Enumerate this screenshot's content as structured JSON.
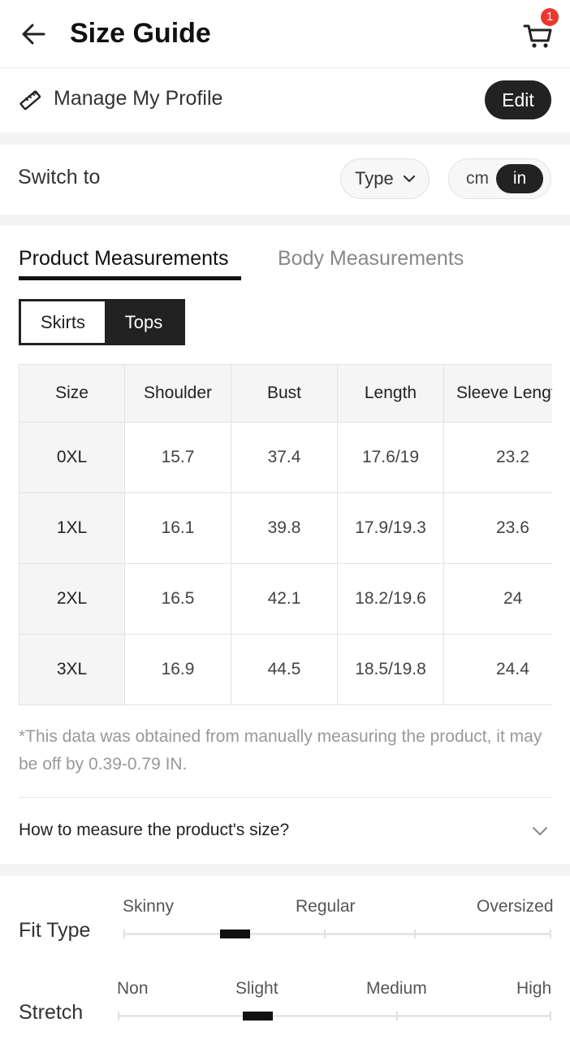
{
  "header": {
    "title": "Size Guide",
    "cart_count": "1"
  },
  "profile": {
    "label": "Manage My Profile",
    "edit_label": "Edit"
  },
  "switch": {
    "label": "Switch to",
    "type_label": "Type",
    "unit_cm": "cm",
    "unit_in": "in",
    "selected_unit": "in"
  },
  "tabs": [
    {
      "label": "Product Measurements",
      "active": true
    },
    {
      "label": "Body Measurements",
      "active": false
    }
  ],
  "segments": [
    {
      "label": "Skirts",
      "active": false
    },
    {
      "label": "Tops",
      "active": true
    }
  ],
  "table": {
    "headers": [
      "Size",
      "Shoulder",
      "Bust",
      "Length",
      "Sleeve Length"
    ],
    "rows": [
      [
        "0XL",
        "15.7",
        "37.4",
        "17.6/19",
        "23.2"
      ],
      [
        "1XL",
        "16.1",
        "39.8",
        "17.9/19.3",
        "23.6"
      ],
      [
        "2XL",
        "16.5",
        "42.1",
        "18.2/19.6",
        "24"
      ],
      [
        "3XL",
        "16.9",
        "44.5",
        "18.5/19.8",
        "24.4"
      ]
    ]
  },
  "disclaimer": "*This data was obtained from manually measuring the product, it may be off by 0.39-0.79 IN.",
  "howto": {
    "label": "How to measure the product's size?"
  },
  "fit": {
    "fit_type": {
      "label": "Fit Type",
      "levels": [
        "Skinny",
        "Regular",
        "Oversized"
      ],
      "value": "between Skinny and Regular"
    },
    "stretch": {
      "label": "Stretch",
      "levels": [
        "Non",
        "Slight",
        "Medium",
        "High"
      ],
      "value": "Slight"
    }
  },
  "colors": {
    "accent": "#222222",
    "badge": "#f0352b",
    "muted_text": "#999999",
    "section_gap": "#f4f4f4"
  },
  "icons": [
    "back-arrow-icon",
    "cart-icon",
    "ruler-pencil-icon",
    "chevron-down-icon"
  ]
}
